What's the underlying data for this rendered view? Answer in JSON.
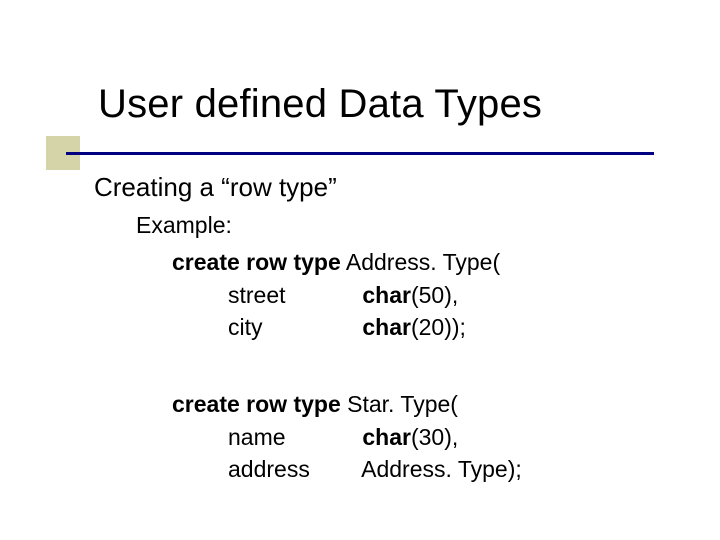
{
  "title": "User defined Data Types",
  "subtitle": "Creating a “row type”",
  "example_label": "Example:",
  "block1": {
    "kw": "create row type",
    "typename": "Address. Type(",
    "rows": [
      {
        "field": "street",
        "dtype_kw": "char",
        "dtype_tail": "(50),"
      },
      {
        "field": "city",
        "dtype_kw": "char",
        "dtype_tail": "(20));"
      }
    ]
  },
  "block2": {
    "kw": "create row type",
    "typename": "Star. Type(",
    "rows": [
      {
        "field": "name",
        "dtype_kw": "char",
        "dtype_tail": "(30),"
      },
      {
        "field": "address",
        "dtype_kw": "",
        "dtype_tail": "Address. Type);"
      }
    ]
  }
}
